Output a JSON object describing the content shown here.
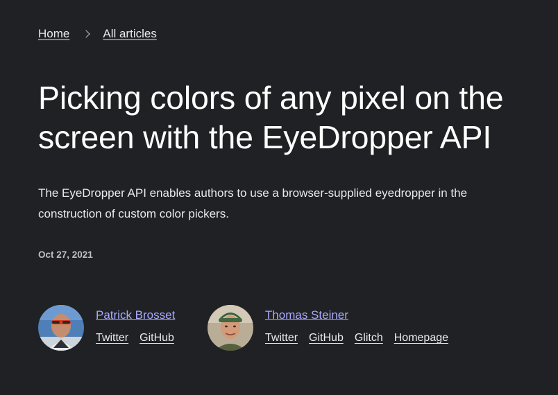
{
  "breadcrumb": {
    "home": "Home",
    "all_articles": "All articles"
  },
  "article": {
    "title": "Picking colors of any pixel on the screen with the EyeDropper API",
    "subtitle": "The EyeDropper API enables authors to use a browser-supplied eyedropper in the construction of custom color pickers.",
    "date": "Oct 27, 2021"
  },
  "authors": [
    {
      "name": "Patrick Brosset",
      "links": [
        "Twitter",
        "GitHub"
      ]
    },
    {
      "name": "Thomas Steiner",
      "links": [
        "Twitter",
        "GitHub",
        "Glitch",
        "Homepage"
      ]
    }
  ],
  "colors": {
    "background": "#202124",
    "accent": "#a8aaff",
    "text": "#e8eaed"
  }
}
